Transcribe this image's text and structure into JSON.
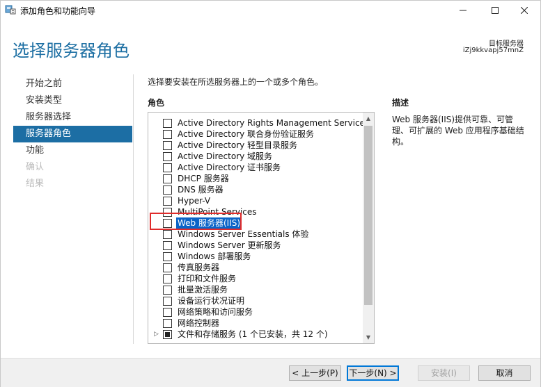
{
  "window": {
    "title": "添加角色和功能向导"
  },
  "header": {
    "heading": "选择服务器角色",
    "target_label": "目标服务器",
    "target_name": "iZj9kkvapj57mnZ"
  },
  "nav": {
    "items": [
      {
        "label": "开始之前",
        "state": "normal"
      },
      {
        "label": "安装类型",
        "state": "normal"
      },
      {
        "label": "服务器选择",
        "state": "normal"
      },
      {
        "label": "服务器角色",
        "state": "active"
      },
      {
        "label": "功能",
        "state": "normal"
      },
      {
        "label": "确认",
        "state": "disabled"
      },
      {
        "label": "结果",
        "state": "disabled"
      }
    ]
  },
  "main": {
    "instruction": "选择要安装在所选服务器上的一个或多个角色。",
    "roles_heading": "角色",
    "description_heading": "描述",
    "description_text": "Web 服务器(IIS)提供可靠、可管理、可扩展的 Web 应用程序基础结构。"
  },
  "roles": [
    {
      "label": "Active Directory Rights Management Services"
    },
    {
      "label": "Active Directory 联合身份验证服务"
    },
    {
      "label": "Active Directory 轻型目录服务"
    },
    {
      "label": "Active Directory 域服务"
    },
    {
      "label": "Active Directory 证书服务"
    },
    {
      "label": "DHCP 服务器"
    },
    {
      "label": "DNS 服务器"
    },
    {
      "label": "Hyper-V"
    },
    {
      "label": "MultiPoint Services"
    },
    {
      "label": "Web 服务器(IIS)"
    },
    {
      "label": "Windows Server Essentials 体验"
    },
    {
      "label": "Windows Server 更新服务"
    },
    {
      "label": "Windows 部署服务"
    },
    {
      "label": "传真服务器"
    },
    {
      "label": "打印和文件服务"
    },
    {
      "label": "批量激活服务"
    },
    {
      "label": "设备运行状况证明"
    },
    {
      "label": "网络策略和访问服务"
    },
    {
      "label": "网络控制器"
    },
    {
      "label": "文件和存储服务 (1 个已安装，共 12 个)"
    }
  ],
  "footer": {
    "prev_label": "< 上一步(P)",
    "next_label": "下一步(N) >",
    "install_label": "安装(I)",
    "cancel_label": "取消"
  },
  "colors": {
    "heading_blue": "#1d6fa3",
    "nav_active": "#1c6ea4",
    "selection": "#0a64c8",
    "annotation_red": "#e02b2b"
  }
}
